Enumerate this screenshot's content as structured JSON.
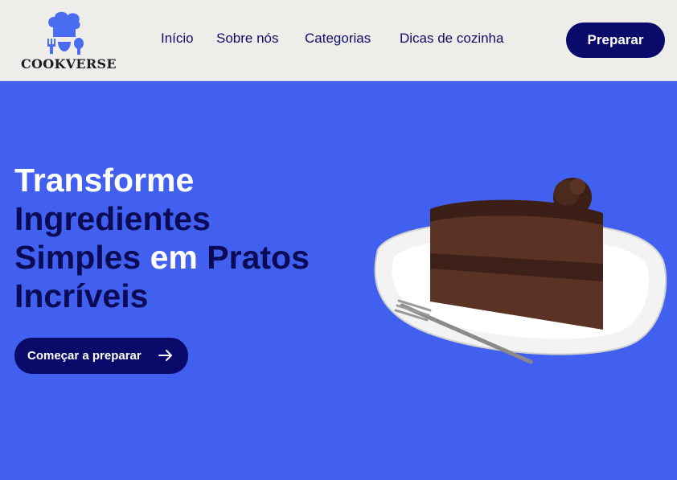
{
  "header": {
    "brand": "COOKVERSE",
    "nav": [
      "Início",
      "Sobre nós",
      "Categorias",
      "Dicas de cozinha"
    ],
    "cta_label": "Preparar"
  },
  "hero": {
    "headline": {
      "line1": "Transforme",
      "line2": "Ingredientes",
      "line3_part1": "Simples ",
      "line3_part2": "em ",
      "line3_part3": "Pratos",
      "line4": "Incríveis"
    },
    "start_label": "Começar a preparar"
  },
  "colors": {
    "hero_bg": "#4260ef",
    "header_bg": "#efedea",
    "navy": "#0a0a6b",
    "logo_blue": "#4a6cf0"
  },
  "icons": {
    "logo": "chef-hat-utensils-icon",
    "start_button": "arrow-right-icon"
  }
}
